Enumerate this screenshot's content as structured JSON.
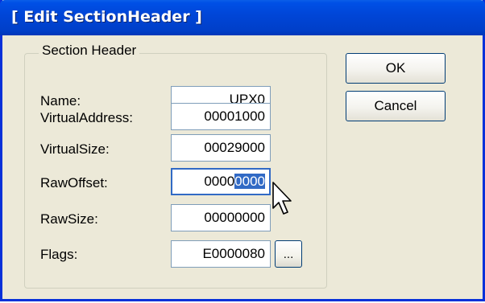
{
  "window": {
    "title": "[ Edit SectionHeader ]"
  },
  "groupbox": {
    "label": "Section Header"
  },
  "fields": {
    "name": {
      "label": "Name:",
      "value": "UPX0"
    },
    "virtual_address": {
      "label": "VirtualAddress:",
      "value": "00001000"
    },
    "virtual_size": {
      "label": "VirtualSize:",
      "value": "00029000"
    },
    "raw_offset": {
      "label": "RawOffset:",
      "value_unselected": "0000",
      "value_selected": "0000"
    },
    "raw_size": {
      "label": "RawSize:",
      "value": "00000000"
    },
    "flags": {
      "label": "Flags:",
      "value": "E0000080"
    }
  },
  "buttons": {
    "ok": "OK",
    "cancel": "Cancel",
    "flags_ellipsis": "..."
  },
  "colors": {
    "titlebar": "#0046d8",
    "dialog_bg": "#ece9d8",
    "selection": "#316ac5"
  },
  "icons": {
    "cursor": "arrow-cursor-icon"
  }
}
